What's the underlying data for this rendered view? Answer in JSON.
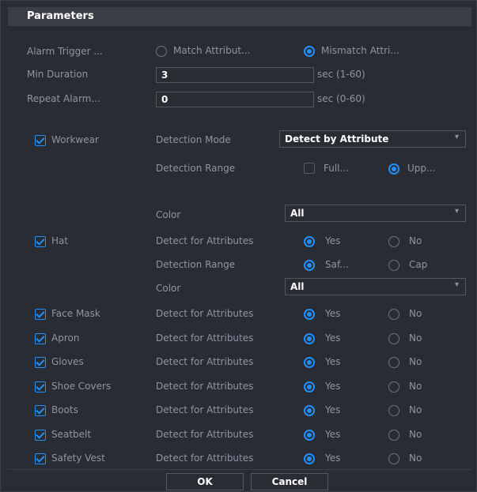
{
  "title": "Parameters",
  "alarm_trigger": {
    "label": "Alarm Trigger ...",
    "option_match": "Match Attribut...",
    "option_mismatch": "Mismatch Attri..."
  },
  "min_duration": {
    "label": "Min Duration",
    "value": "3",
    "unit": "sec (1-60)"
  },
  "repeat_alarm": {
    "label": "Repeat Alarm...",
    "value": "0",
    "unit": "sec (0-60)"
  },
  "workwear": {
    "label": "Workwear",
    "detection_mode_label": "Detection Mode",
    "detection_mode_value": "Detect by Attribute",
    "detection_range_label": "Detection Range",
    "range_full": "Full...",
    "range_upper": "Upp...",
    "color_label": "Color",
    "color_value": "All"
  },
  "hat": {
    "label": "Hat",
    "detect_label": "Detect for Attributes",
    "yes": "Yes",
    "no": "No",
    "detection_range_label": "Detection Range",
    "range_safety": "Saf...",
    "range_cap": "Cap",
    "color_label": "Color",
    "color_value": "All"
  },
  "attribute_rows": [
    {
      "label": "Face Mask",
      "detect": "Detect for Attributes",
      "yes": "Yes",
      "no": "No"
    },
    {
      "label": "Apron",
      "detect": "Detect for Attributes",
      "yes": "Yes",
      "no": "No"
    },
    {
      "label": "Gloves",
      "detect": "Detect for Attributes",
      "yes": "Yes",
      "no": "No"
    },
    {
      "label": "Shoe Covers",
      "detect": "Detect for Attributes",
      "yes": "Yes",
      "no": "No"
    },
    {
      "label": "Boots",
      "detect": "Detect for Attributes",
      "yes": "Yes",
      "no": "No"
    },
    {
      "label": "Seatbelt",
      "detect": "Detect for Attributes",
      "yes": "Yes",
      "no": "No"
    },
    {
      "label": "Safety Vest",
      "detect": "Detect for Attributes",
      "yes": "Yes",
      "no": "No"
    }
  ],
  "buttons": {
    "ok": "OK",
    "cancel": "Cancel"
  },
  "icons": {
    "dropdown": "chevron-down-icon",
    "check": "checkmark-icon"
  },
  "colors": {
    "accent": "#1e90ff",
    "background": "#2a2c33",
    "header": "#3a3d46"
  }
}
